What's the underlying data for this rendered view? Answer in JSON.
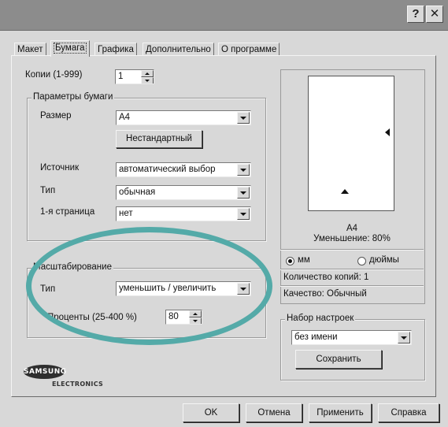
{
  "titlebar": {
    "help_glyph": "?",
    "close_glyph": "✕"
  },
  "tabs": [
    "Макет",
    "Бумага",
    "Графика",
    "Дополнительно",
    "О программе"
  ],
  "copies": {
    "label": "Копии (1-999)",
    "value": "1"
  },
  "paper_group": {
    "legend": "Параметры бумаги",
    "size_label": "Размер",
    "size_value": "A4",
    "custom_button": "Нестандартный",
    "source_label": "Источник",
    "source_value": "автоматический выбор",
    "type_label": "Тип",
    "type_value": "обычная",
    "first_page_label": "1-я страница",
    "first_page_value": "нет"
  },
  "scaling_group": {
    "legend": "Масштабирование",
    "type_label": "Тип",
    "type_value": "уменьшить / увеличить",
    "percent_label": "Проценты (25-400 %)",
    "percent_value": "80"
  },
  "preview": {
    "paper": "A4",
    "reduction": "Уменьшение: 80%",
    "unit_mm": "мм",
    "unit_inch": "дюймы",
    "copies_info": "Количество копий: 1",
    "quality_info": "Качество: Обычный"
  },
  "presets": {
    "legend": "Набор настроек",
    "value": "без имени",
    "save_button": "Сохранить"
  },
  "logo": {
    "brand": "SAMSUNG",
    "sub": "ELECTRONICS"
  },
  "buttons": {
    "ok": "OK",
    "cancel": "Отмена",
    "apply": "Применить",
    "help": "Справка"
  },
  "colors": {
    "highlight_ellipse": "#54aaa8"
  }
}
